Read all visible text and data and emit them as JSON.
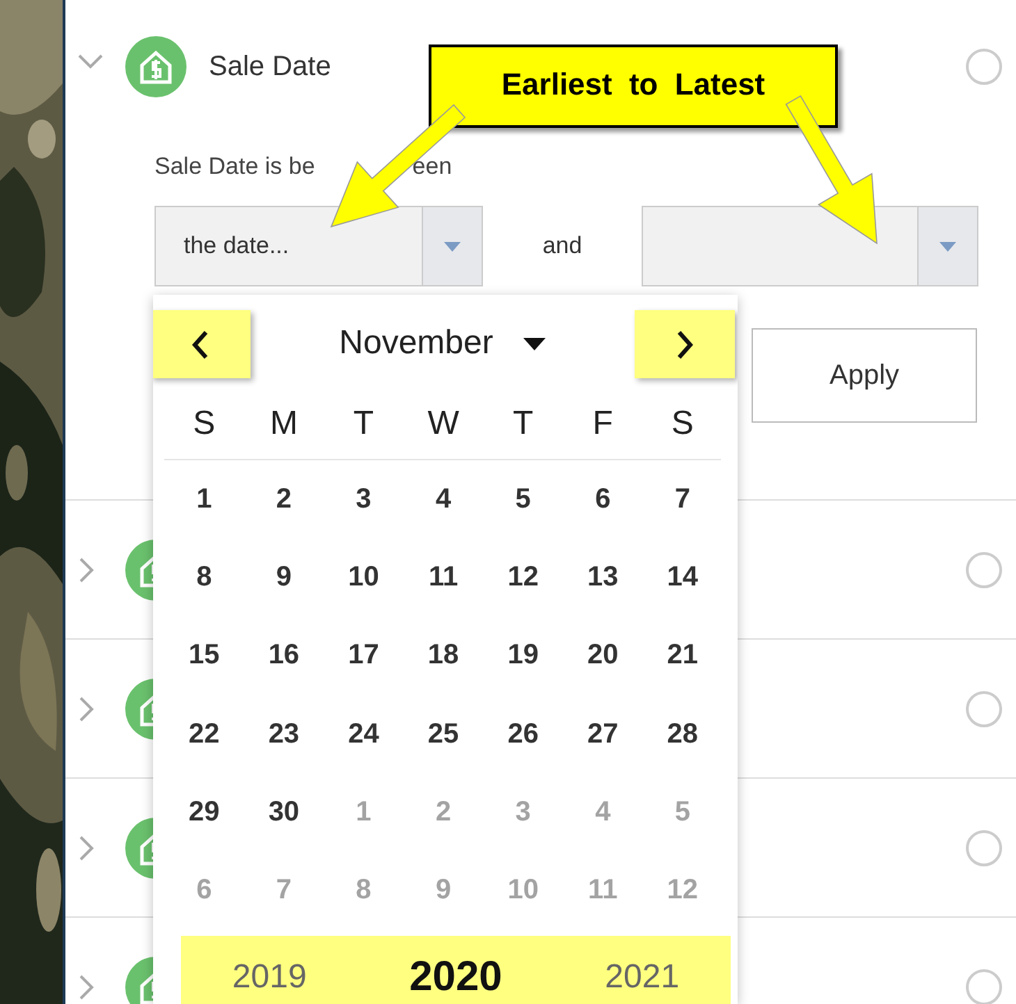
{
  "filters": [
    {
      "title": "Sale Date",
      "expanded": true,
      "selected": false,
      "condition": {
        "label_parts": [
          "Sale Date is be",
          "een"
        ],
        "from_value": "the date...",
        "joiner": "and",
        "apply": "Apply"
      }
    },
    {
      "expanded": false,
      "selected": false
    },
    {
      "expanded": false,
      "selected": false
    },
    {
      "expanded": false,
      "selected": false
    },
    {
      "expanded": false,
      "selected": false
    }
  ],
  "date_picker": {
    "month": "November",
    "weekdays": [
      "S",
      "M",
      "T",
      "W",
      "T",
      "F",
      "S"
    ],
    "days": [
      {
        "day": "1",
        "in_month": true
      },
      {
        "day": "2",
        "in_month": true
      },
      {
        "day": "3",
        "in_month": true
      },
      {
        "day": "4",
        "in_month": true
      },
      {
        "day": "5",
        "in_month": true
      },
      {
        "day": "6",
        "in_month": true
      },
      {
        "day": "7",
        "in_month": true
      },
      {
        "day": "8",
        "in_month": true
      },
      {
        "day": "9",
        "in_month": true
      },
      {
        "day": "10",
        "in_month": true
      },
      {
        "day": "11",
        "in_month": true
      },
      {
        "day": "12",
        "in_month": true
      },
      {
        "day": "13",
        "in_month": true
      },
      {
        "day": "14",
        "in_month": true
      },
      {
        "day": "15",
        "in_month": true
      },
      {
        "day": "16",
        "in_month": true
      },
      {
        "day": "17",
        "in_month": true
      },
      {
        "day": "18",
        "in_month": true
      },
      {
        "day": "19",
        "in_month": true
      },
      {
        "day": "20",
        "in_month": true
      },
      {
        "day": "21",
        "in_month": true
      },
      {
        "day": "22",
        "in_month": true
      },
      {
        "day": "23",
        "in_month": true
      },
      {
        "day": "24",
        "in_month": true
      },
      {
        "day": "25",
        "in_month": true
      },
      {
        "day": "26",
        "in_month": true
      },
      {
        "day": "27",
        "in_month": true
      },
      {
        "day": "28",
        "in_month": true
      },
      {
        "day": "29",
        "in_month": true
      },
      {
        "day": "30",
        "in_month": true
      },
      {
        "day": "1",
        "in_month": false
      },
      {
        "day": "2",
        "in_month": false
      },
      {
        "day": "3",
        "in_month": false
      },
      {
        "day": "4",
        "in_month": false
      },
      {
        "day": "5",
        "in_month": false
      },
      {
        "day": "6",
        "in_month": false
      },
      {
        "day": "7",
        "in_month": false
      },
      {
        "day": "8",
        "in_month": false
      },
      {
        "day": "9",
        "in_month": false
      },
      {
        "day": "10",
        "in_month": false
      },
      {
        "day": "11",
        "in_month": false
      },
      {
        "day": "12",
        "in_month": false
      }
    ],
    "years": [
      {
        "label": "2019",
        "selected": false
      },
      {
        "label": "2020",
        "selected": true
      },
      {
        "label": "2021",
        "selected": false
      }
    ]
  },
  "callout": {
    "text": "Earliest to Latest"
  }
}
